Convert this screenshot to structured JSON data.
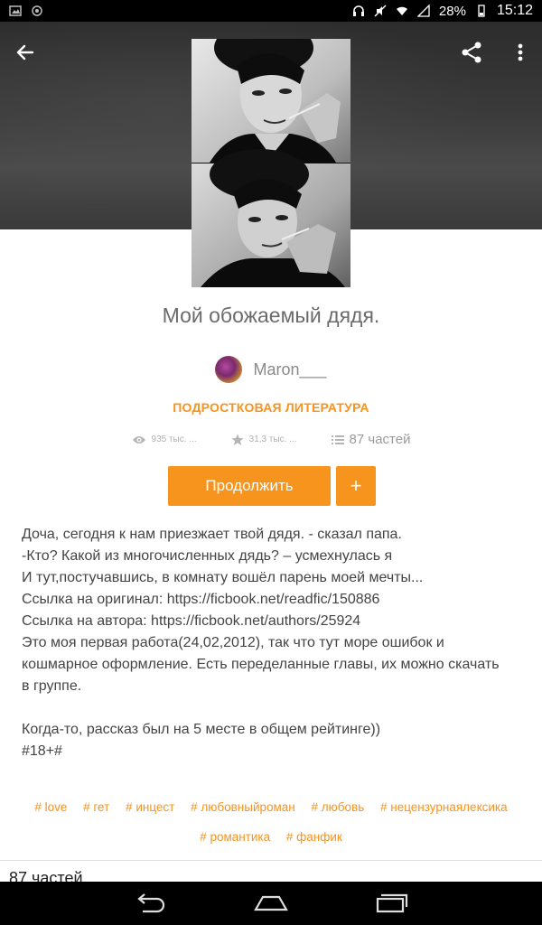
{
  "status_bar": {
    "battery": "28%",
    "time": "15:12"
  },
  "story": {
    "title": "Мой обожаемый дядя.",
    "author": "Maron___",
    "category": "ПОДРОСТКОВАЯ ЛИТЕРАТУРА",
    "views": "935 тыс. ...",
    "votes": "31,3 тыс. ...",
    "parts": "87 частей"
  },
  "actions": {
    "continue_label": "Продолжить",
    "add_label": "+"
  },
  "description": [
    "Доча, сегодня к нам приезжает твой дядя. - сказал папа.",
    "-Кто? Какой из многочисленных дядь? – усмехнулась я",
    "И тут,постучавшись, в комнату вошёл парень моей мечты...",
    "Ссылка на оригинал: https://ficbook.net/readfic/150886",
    "Ссылка на автора: https://ficbook.net/authors/25924",
    "Это моя первая работа(24,02,2012), так что тут море ошибок и",
    "кошмарное оформление. Есть переделанные главы, их можно скачать",
    "в группе.",
    "",
    "Когда-то, рассказ был на 5 месте в общем рейтинге))",
    "#18+#"
  ],
  "tags": [
    "# love",
    "# гет",
    "# инцест",
    "# любовныйроман",
    "# любовь",
    "# нецензурнаялексика",
    "# романтика",
    "# фанфик"
  ],
  "footer": {
    "parts_label": "87 частей"
  },
  "colors": {
    "accent": "#f7941d",
    "header_bg": "#3a3a3a"
  },
  "icons": [
    "back-arrow-icon",
    "share-icon",
    "more-vert-icon",
    "eye-icon",
    "star-icon",
    "list-icon",
    "nav-back-icon",
    "nav-home-icon",
    "nav-recents-icon"
  ]
}
